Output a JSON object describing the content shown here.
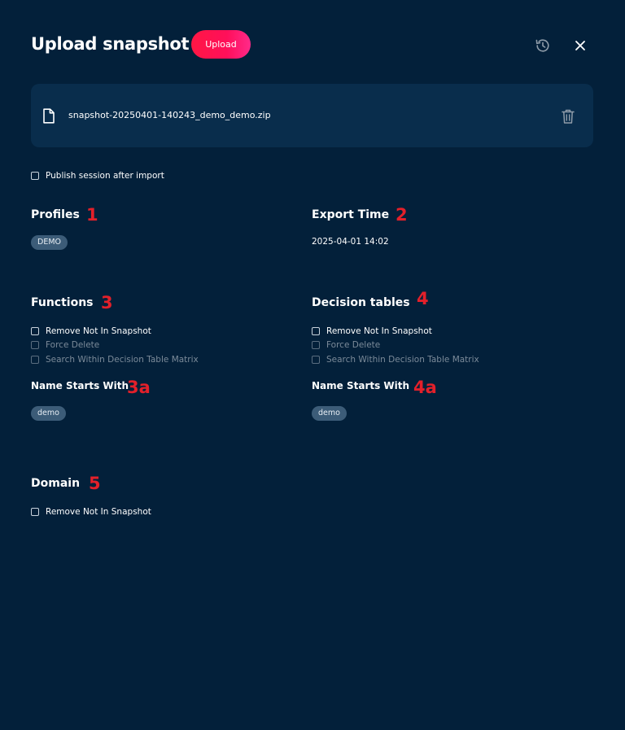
{
  "header": {
    "title": "Upload snapshot",
    "upload_label": "Upload"
  },
  "file": {
    "name": "snapshot-20250401-140243_demo_demo.zip"
  },
  "publish": {
    "label": "Publish session after import"
  },
  "profiles": {
    "title": "Profiles",
    "annotation": "1",
    "chips": [
      "DEMO"
    ]
  },
  "export_time": {
    "title": "Export Time",
    "annotation": "2",
    "value": "2025-04-01 14:02"
  },
  "functions": {
    "title": "Functions",
    "annotation": "3",
    "options": [
      {
        "label": "Remove Not In Snapshot",
        "disabled": false
      },
      {
        "label": "Force Delete",
        "disabled": true
      },
      {
        "label": "Search Within Decision Table Matrix",
        "disabled": true
      }
    ],
    "name_starts_with": {
      "title": "Name Starts With",
      "annotation": "3a",
      "chips": [
        "demo"
      ]
    }
  },
  "decision_tables": {
    "title": "Decision tables",
    "annotation": "4",
    "options": [
      {
        "label": "Remove Not In Snapshot",
        "disabled": false
      },
      {
        "label": "Force Delete",
        "disabled": true
      },
      {
        "label": "Search Within Decision Table Matrix",
        "disabled": true
      }
    ],
    "name_starts_with": {
      "title": "Name Starts With",
      "annotation": "4a",
      "chips": [
        "demo"
      ]
    }
  },
  "domain": {
    "title": "Domain",
    "annotation": "5",
    "options": [
      {
        "label": "Remove Not In Snapshot",
        "disabled": false
      }
    ]
  },
  "colors": {
    "background": "#03203a",
    "card": "#092d4c",
    "accent": "#ff1744",
    "annotation": "#e3202a",
    "chip": "#3c5c78"
  },
  "icons": {
    "history": "history-icon",
    "close": "close-icon",
    "file": "file-icon",
    "trash": "trash-icon"
  }
}
